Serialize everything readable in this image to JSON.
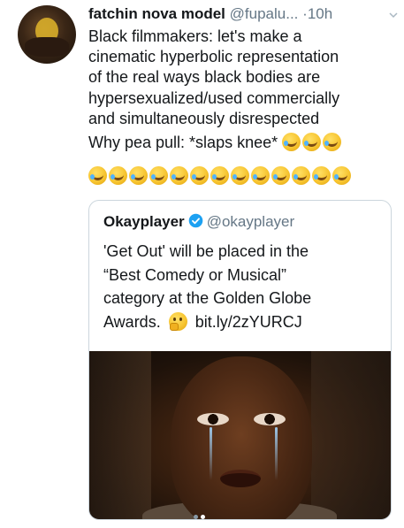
{
  "tweet": {
    "display_name": "fatchin nova model",
    "handle": "@fupalu...",
    "separator": "·",
    "time": "10h",
    "lines": [
      "Black filmmakers: let's make a",
      "cinematic hyperbolic representation",
      "of the real ways black bodies are",
      "hypersexualized/used commercially",
      "and simultaneously disrespected"
    ],
    "last_line": "Why pea pull: *slaps knee*",
    "emoji_name": "rolling-on-floor-laughing-emoji",
    "emoji_count_inline": 3,
    "emoji_count_row": 13
  },
  "quote": {
    "name": "Okayplayer",
    "handle": "@okayplayer",
    "lines": [
      "'Get Out' will be placed in the",
      "“Best Comedy or Musical”",
      "category at the Golden Globe"
    ],
    "last_line_prefix": "Awards.",
    "link": "bit.ly/2zYURCJ",
    "thinking_emoji": "thinking-face-emoji",
    "image_pager": {
      "count": 2,
      "active": 1
    }
  }
}
